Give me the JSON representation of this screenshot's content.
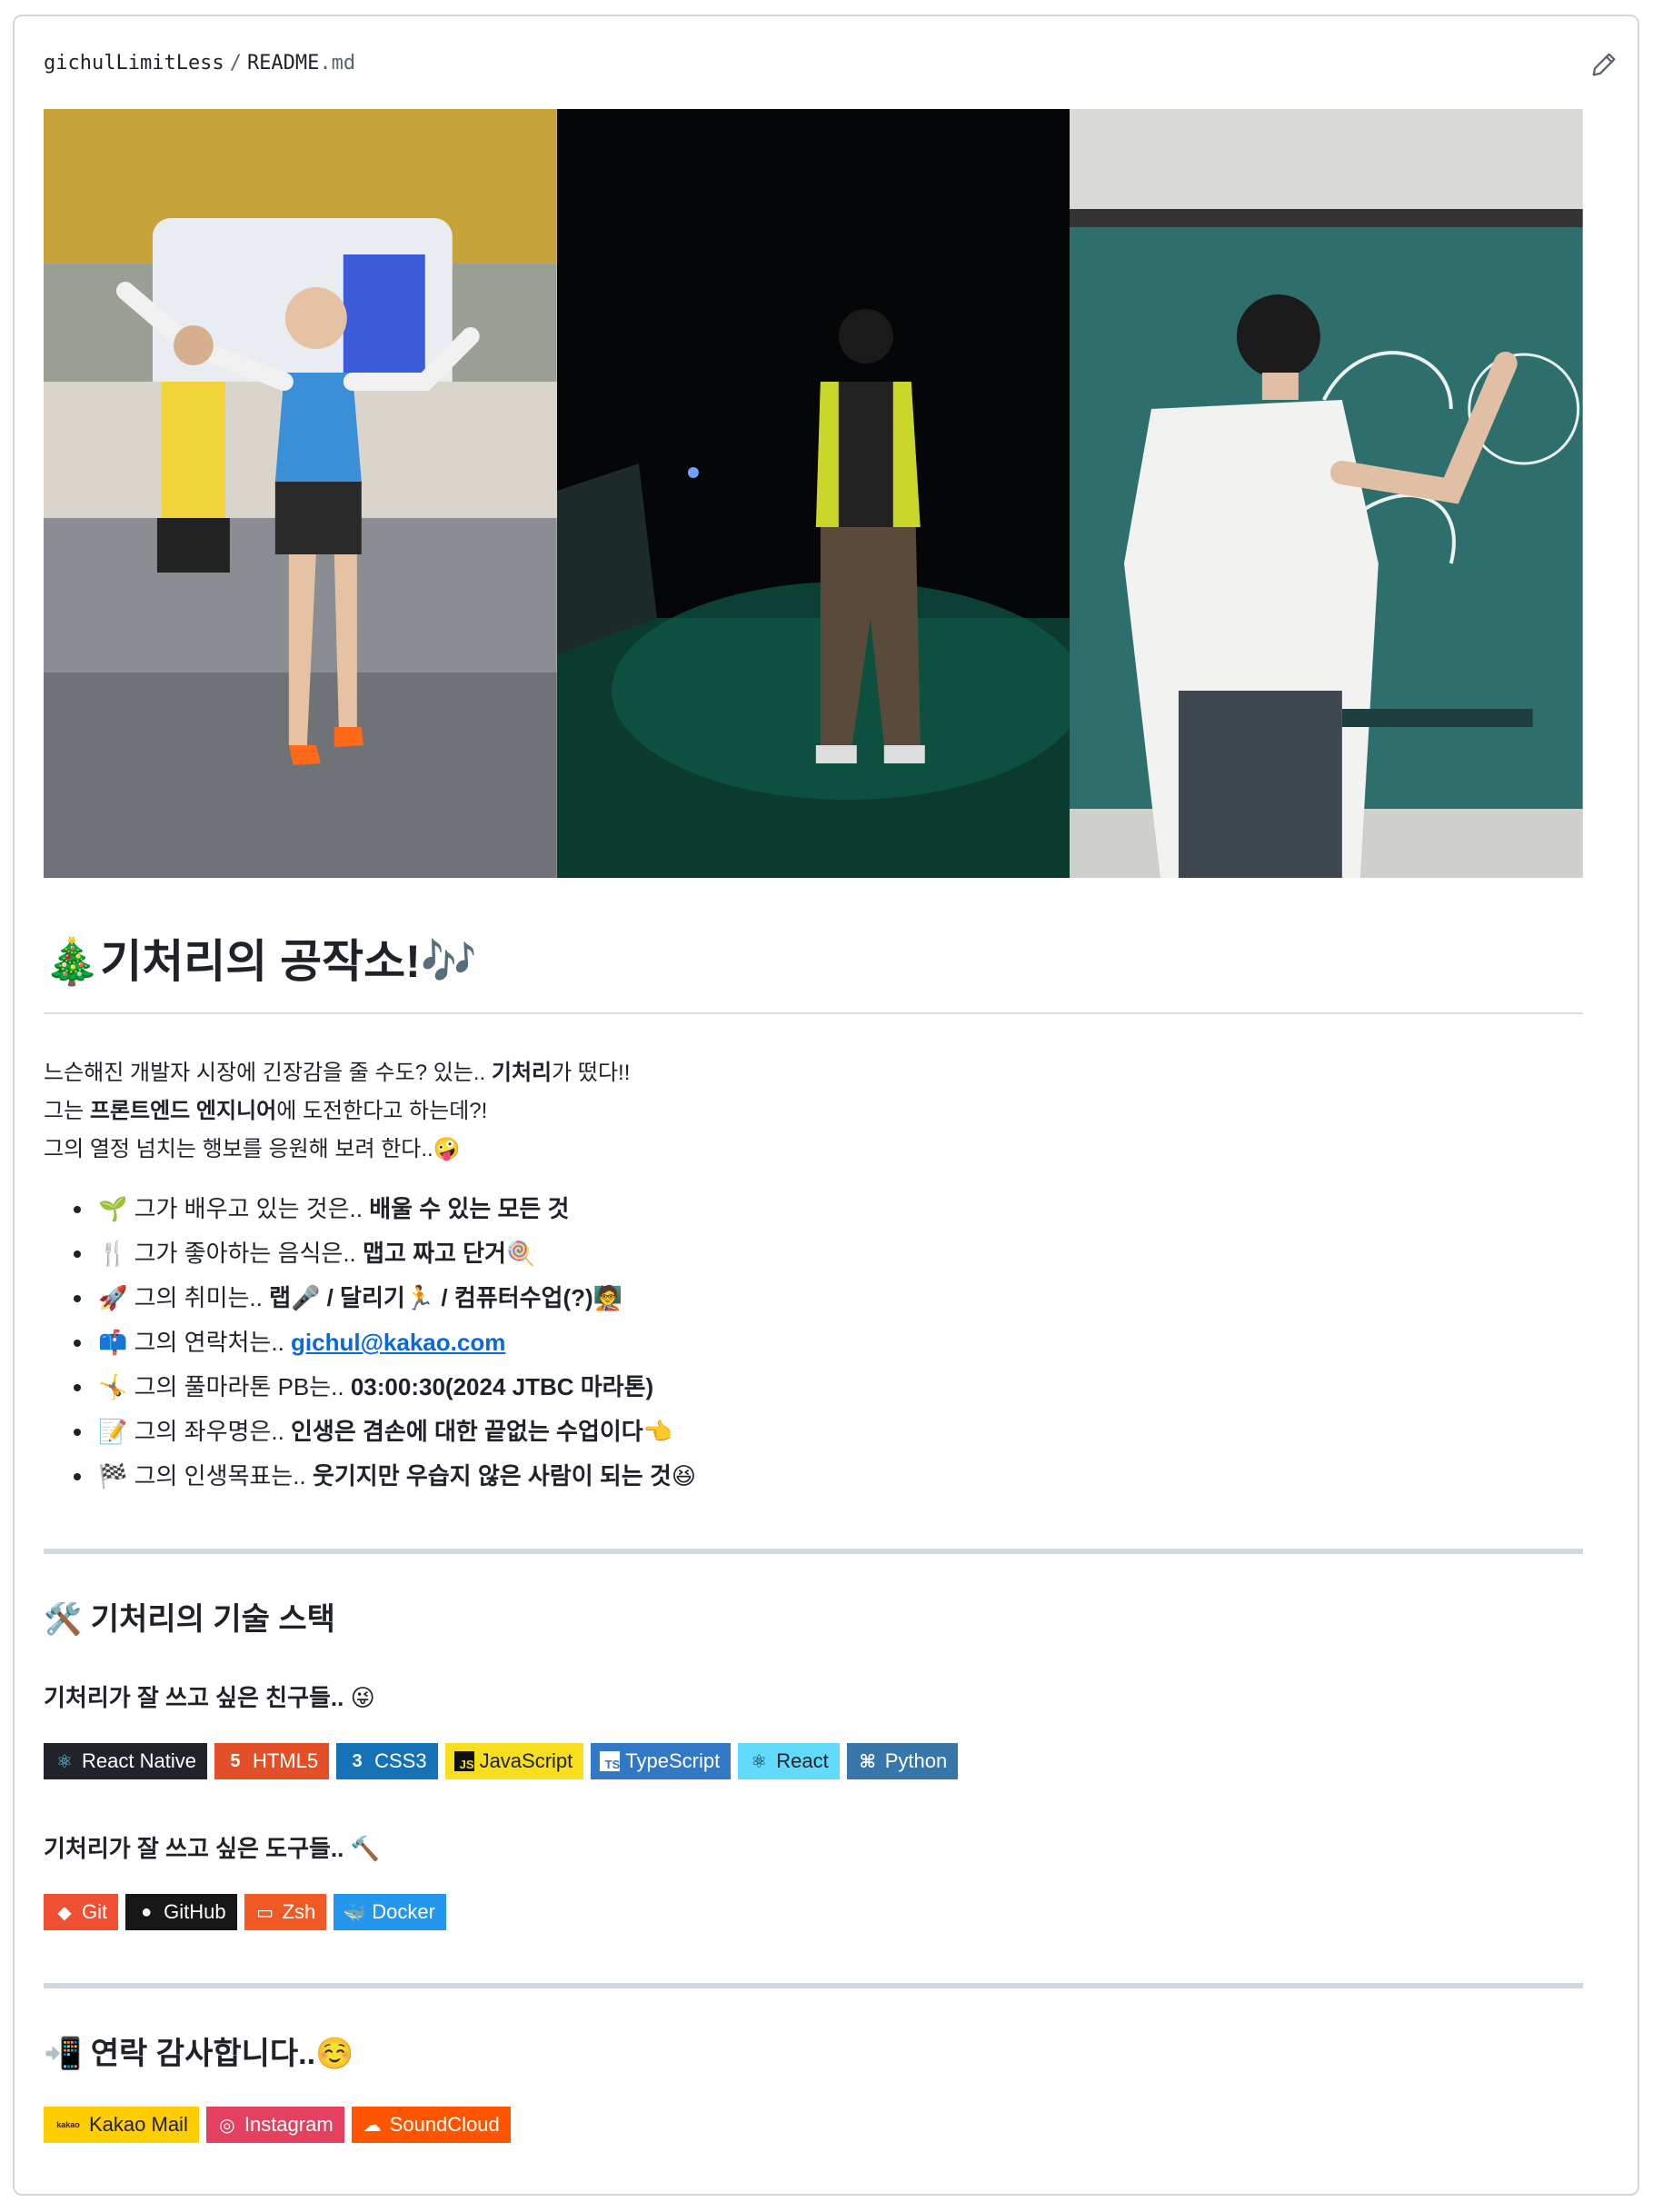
{
  "header": {
    "owner": "gichulLimitLess",
    "separator": "/",
    "file_base": "README",
    "file_ext": ".md"
  },
  "readme": {
    "title": "🎄기처리의 공작소!🎶",
    "intro": [
      {
        "pre": "느슨해진 개발자 시장에 긴장감을 줄 수도? 있는.. ",
        "bold": "기처리",
        "post": "가 떴다!!"
      },
      {
        "pre": "그는 ",
        "bold": "프론트엔드 엔지니어",
        "post": "에 도전한다고 하는데?!"
      },
      {
        "pre": "그의 열정 넘치는 행보를 응원해 보려 한다..🤪",
        "bold": "",
        "post": ""
      }
    ],
    "facts": [
      {
        "text": "🌱 그가 배우고 있는 것은.. ",
        "bold": "배울 수 있는 모든 것"
      },
      {
        "text": "🍴 그가 좋아하는 음식은.. ",
        "bold": "맵고 짜고 단거🍭"
      },
      {
        "text": "🚀 그의 취미는.. ",
        "bold": "랩🎤 / 달리기🏃 / 컴퓨터수업(?)🧑‍🏫"
      },
      {
        "text": "📫 그의 연락처는.. ",
        "link": "gichul@kakao.com"
      },
      {
        "text": "🤸 그의 풀마라톤 PB는.. ",
        "bold": "03:00:30(2024 JTBC 마라톤)"
      },
      {
        "text": "📝 그의 좌우명은.. ",
        "bold": "인생은 겸손에 대한 끝없는 수업이다👈"
      },
      {
        "text": "🏁 그의 인생목표는.. ",
        "bold": "웃기지만 우습지 않은 사람이 되는 것😆"
      }
    ],
    "tech_heading": "🛠️ 기처리의 기술 스택",
    "languages_heading": "기처리가 잘 쓰고 싶은 친구들.. 😜",
    "languages": [
      {
        "label": "React Native",
        "bg": "#20232a",
        "icon": "react-icon",
        "glyph": "⚛",
        "glyph_color": "#61dafb"
      },
      {
        "label": "HTML5",
        "bg": "#e34f26",
        "icon": "html5-icon",
        "glyph": "5",
        "glyph_color": "#ffffff"
      },
      {
        "label": "CSS3",
        "bg": "#1572b6",
        "icon": "css3-icon",
        "glyph": "3",
        "glyph_color": "#ffffff"
      },
      {
        "label": "JavaScript",
        "bg": "#f7df1e",
        "icon": "javascript-icon",
        "glyph": "JS",
        "glyph_color": "#f7df1e"
      },
      {
        "label": "TypeScript",
        "bg": "#3178c6",
        "icon": "typescript-icon",
        "glyph": "TS",
        "glyph_color": "#3178c6"
      },
      {
        "label": "React",
        "bg": "#61dafb",
        "icon": "react-icon",
        "glyph": "⚛",
        "glyph_color": "#20232a"
      },
      {
        "label": "Python",
        "bg": "#3776ab",
        "icon": "python-icon",
        "glyph": "⌘",
        "glyph_color": "#ffffff"
      }
    ],
    "tools_heading": "기처리가 잘 쓰고 싶은 도구들.. 🔨",
    "tools": [
      {
        "label": "Git",
        "bg": "#f05032",
        "icon": "git-icon",
        "glyph": "◆",
        "glyph_color": "#ffffff"
      },
      {
        "label": "GitHub",
        "bg": "#181717",
        "icon": "github-icon",
        "glyph": "●",
        "glyph_color": "#ffffff"
      },
      {
        "label": "Zsh",
        "bg": "#f15a24",
        "icon": "terminal-icon",
        "glyph": "▭",
        "glyph_color": "#ffffff"
      },
      {
        "label": "Docker",
        "bg": "#2496ed",
        "icon": "docker-icon",
        "glyph": "🐳",
        "glyph_color": "#ffffff"
      }
    ],
    "contact_heading": "📲 연락 감사합니다..☺️",
    "contacts": [
      {
        "label": "Kakao Mail",
        "bg": "#ffcd00",
        "icon": "kakao-icon",
        "glyph": "kakao",
        "glyph_color": "#3c1e1e",
        "text_color": "#1f2328"
      },
      {
        "label": "Instagram",
        "bg": "#e4405f",
        "icon": "instagram-icon",
        "glyph": "◎",
        "glyph_color": "#ffffff",
        "text_color": "#ffffff"
      },
      {
        "label": "SoundCloud",
        "bg": "#ff5500",
        "icon": "soundcloud-icon",
        "glyph": "☁",
        "glyph_color": "#ffffff",
        "text_color": "#ffffff"
      }
    ]
  }
}
